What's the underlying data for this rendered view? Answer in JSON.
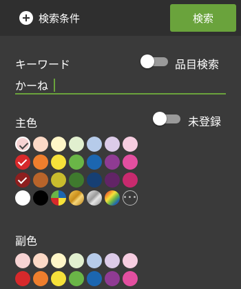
{
  "header": {
    "conditions_label": "検索条件",
    "search_label": "検索"
  },
  "keyword": {
    "label": "キーワード",
    "toggle_label": "品目検索",
    "value": "かーね"
  },
  "main_color": {
    "label": "主色",
    "toggle_label": "未登録",
    "rows": [
      [
        "#f7d3d3",
        "#fcd9c6",
        "#fff6c8",
        "#e1efcf",
        "#b6cbea",
        "#dccbe8",
        "#f6cde0"
      ],
      [
        "#d7292b",
        "#ee7e2d",
        "#f6e13a",
        "#6ab547",
        "#1c66b0",
        "#8f3b93",
        "#e34fa0"
      ],
      [
        "#8d1f1f",
        "#b8642a",
        "#c9bc2d",
        "#3f7a2e",
        "#163f73",
        "#622466",
        "#c82a6e"
      ],
      [
        "#ffffff",
        "#000000",
        "multi",
        "gold",
        "silver",
        "rainbow",
        "more"
      ]
    ],
    "checked_rows": [
      0,
      1,
      2
    ]
  },
  "sub_color": {
    "label": "副色",
    "rows": [
      [
        "#f7d3d3",
        "#fcd9c6",
        "#fff6c8",
        "#e1efcf",
        "#b6cbea",
        "#dccbe8",
        "#f6cde0"
      ],
      [
        "#d7292b",
        "#ee7e2d",
        "#f6e13a",
        "#6ab547",
        "#1c66b0",
        "#8f3b93",
        "#e34fa0"
      ]
    ]
  }
}
